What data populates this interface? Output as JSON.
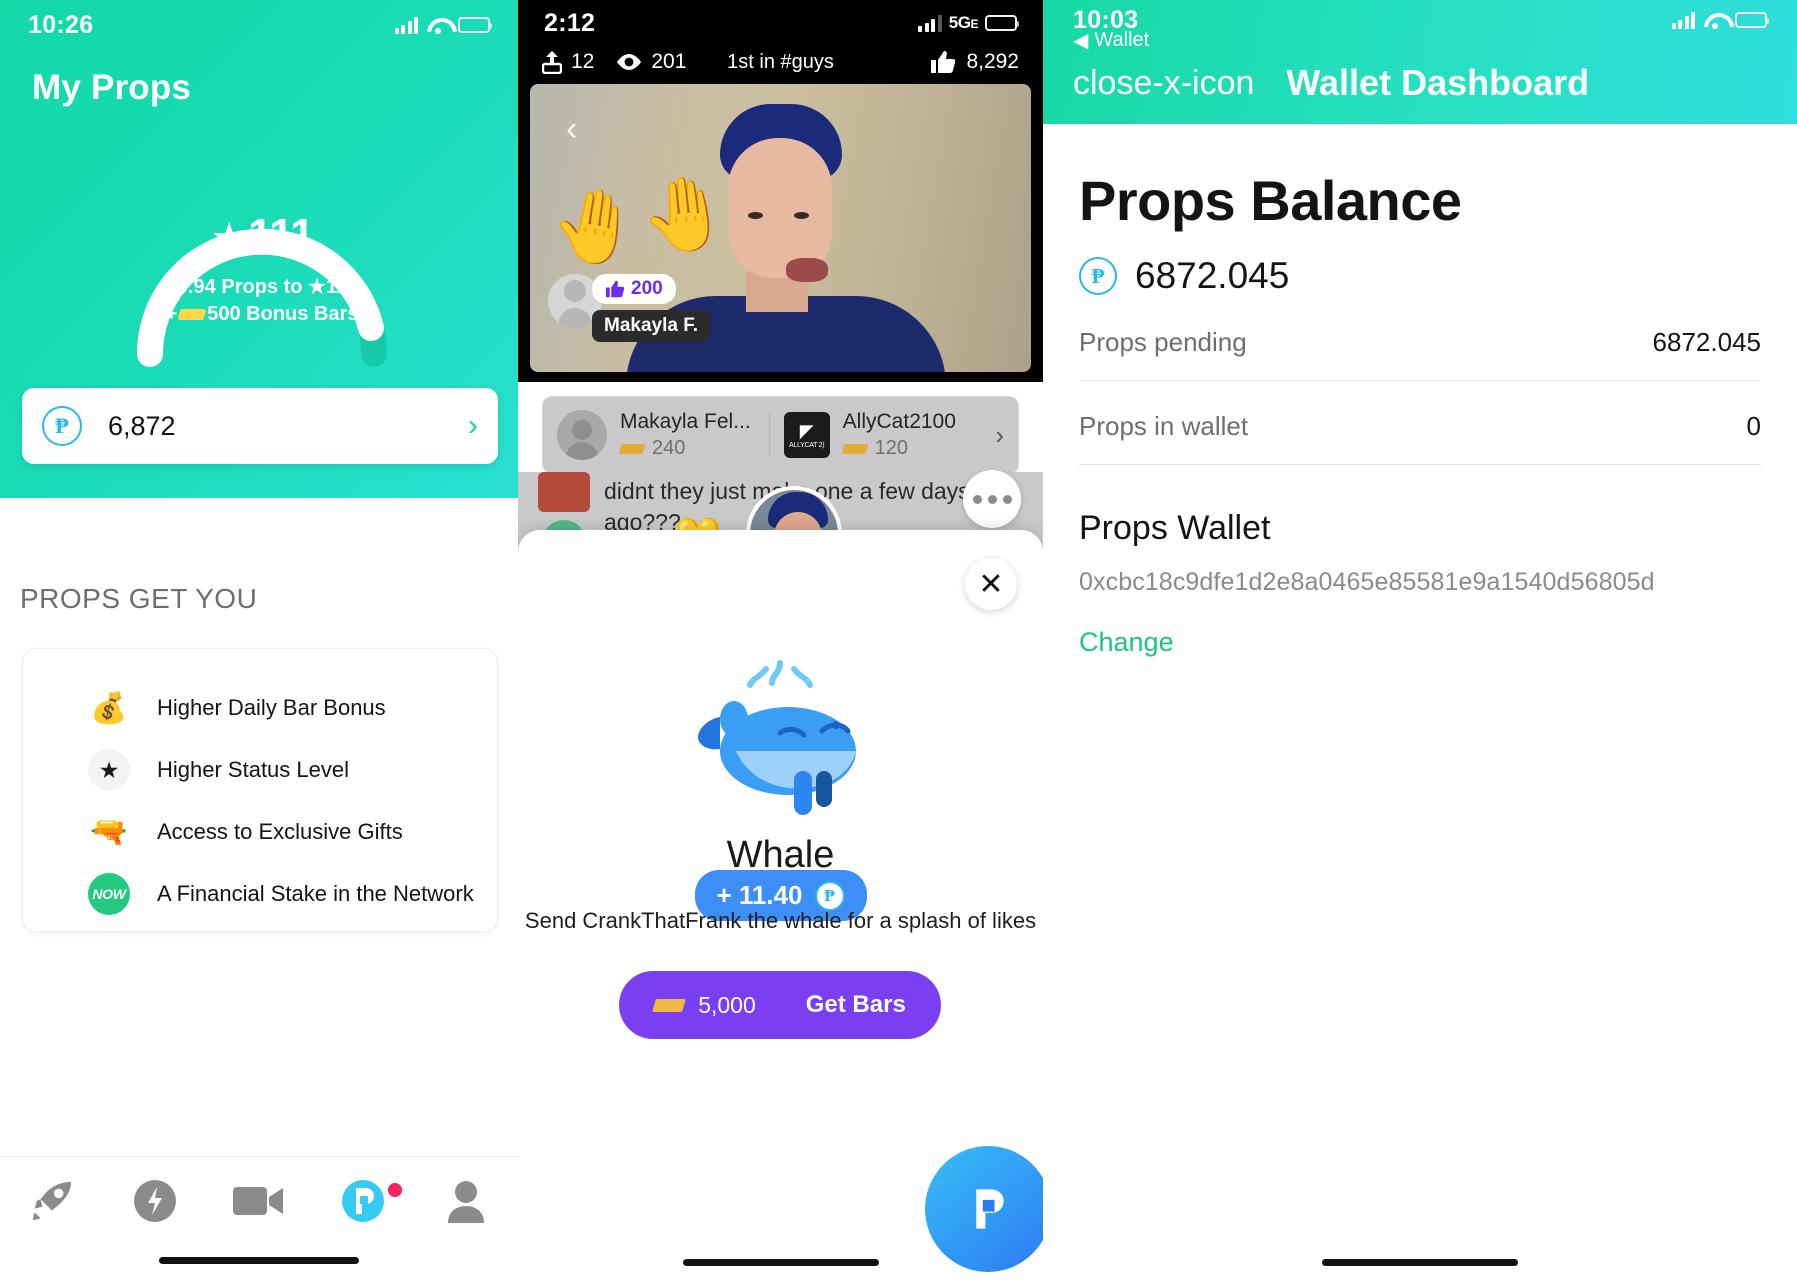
{
  "panel1": {
    "status": {
      "time": "10:26",
      "signal_icon": "cellular-bars-icon",
      "wifi_icon": "wifi-icon",
      "battery_icon": "battery-icon"
    },
    "title": "My Props",
    "gauge": {
      "star_glyph": "★",
      "level": "111",
      "next_line1": "19.94 Props to ★112",
      "next_line2_prefix": "+",
      "next_line2": "500 Bonus Bars",
      "progress_percent": 87
    },
    "balance": {
      "amount": "6,872",
      "coin_glyph": "₱",
      "chevron": "›"
    },
    "section_title": "PROPS GET YOU",
    "features": [
      {
        "icon": "gold-bars-icon",
        "glyph": "💰",
        "label": "Higher Daily Bar Bonus"
      },
      {
        "icon": "star-icon",
        "glyph": "★",
        "label": "Higher Status Level"
      },
      {
        "icon": "cannon-gift-icon",
        "glyph": "🔫",
        "label": "Access to Exclusive Gifts"
      },
      {
        "icon": "now-badge-icon",
        "glyph": "NOW",
        "label": "A Financial Stake in the Network"
      }
    ],
    "tabs": [
      {
        "name": "tab-rocket",
        "icon": "rocket-icon",
        "active": false
      },
      {
        "name": "tab-bolt",
        "icon": "bolt-icon",
        "active": false
      },
      {
        "name": "tab-video",
        "icon": "video-camera-icon",
        "active": false
      },
      {
        "name": "tab-props",
        "icon": "props-logo-icon",
        "active": true,
        "badge": true
      },
      {
        "name": "tab-profile",
        "icon": "person-icon",
        "active": false
      }
    ]
  },
  "panel2": {
    "status": {
      "time": "2:12",
      "network": "5G",
      "network_sub": "E",
      "signal_icon": "cellular-bars-icon",
      "battery_icon": "battery-icon"
    },
    "stats": {
      "share_icon": "share-icon",
      "shares": "12",
      "views_icon": "eye-icon",
      "views": "201",
      "rank": "1st  in #guys",
      "like_icon": "thumbs-up-icon",
      "likes": "8,292"
    },
    "video": {
      "back_icon": "chevron-left-icon",
      "overlay_user": {
        "likes": "200",
        "like_icon": "thumbs-up-icon",
        "name": "Makayla F."
      }
    },
    "leaderboard": [
      {
        "name": "Makayla Fel...",
        "bars": "240",
        "avatar": "person-avatar-icon"
      },
      {
        "name": "AllyCat2100",
        "bars": "120",
        "avatar": "allycat-avatar-icon",
        "avatar_label": "ALLYCAT 2)"
      }
    ],
    "leaderboard_chevron": "›",
    "comment": "didnt they just make one a few days ago???",
    "more_icon": "ellipsis-icon",
    "sheet": {
      "close_icon": "close-x-icon",
      "gift_name": "Whale",
      "gift_icon": "whale-icon",
      "props_reward": "+ 11.40",
      "props_coin_glyph": "₱",
      "description": "Send CrankThatFrank the whale for a splash of likes",
      "get_bars": {
        "bar_icon": "gold-bar-icon",
        "amount": "5,000",
        "label": "Get Bars"
      }
    },
    "fab_icon": "props-logo-icon"
  },
  "panel3": {
    "status": {
      "time": "10:03",
      "signal_icon": "cellular-bars-icon",
      "wifi_icon": "wifi-icon",
      "battery_icon": "battery-icon"
    },
    "back_label": "Wallet",
    "back_icon": "triangle-left-icon",
    "close_icon": "close-x-icon",
    "title": "Wallet Dashboard",
    "balance_heading": "Props Balance",
    "balance_amount": "6872.045",
    "balance_coin_glyph": "₱",
    "rows": [
      {
        "key": "Props pending",
        "value": "6872.045"
      },
      {
        "key": "Props in wallet",
        "value": "0"
      }
    ],
    "wallet_heading": "Props Wallet",
    "wallet_address": "0xcbc18c9dfe1d2e8a0465e85581e9a1540d56805d",
    "change_label": "Change"
  },
  "colors": {
    "teal": "#17d9a6",
    "purple": "#7B3FF2",
    "blue": "#3E8EF7",
    "green": "#22C37E",
    "gold": "#F0B942"
  }
}
